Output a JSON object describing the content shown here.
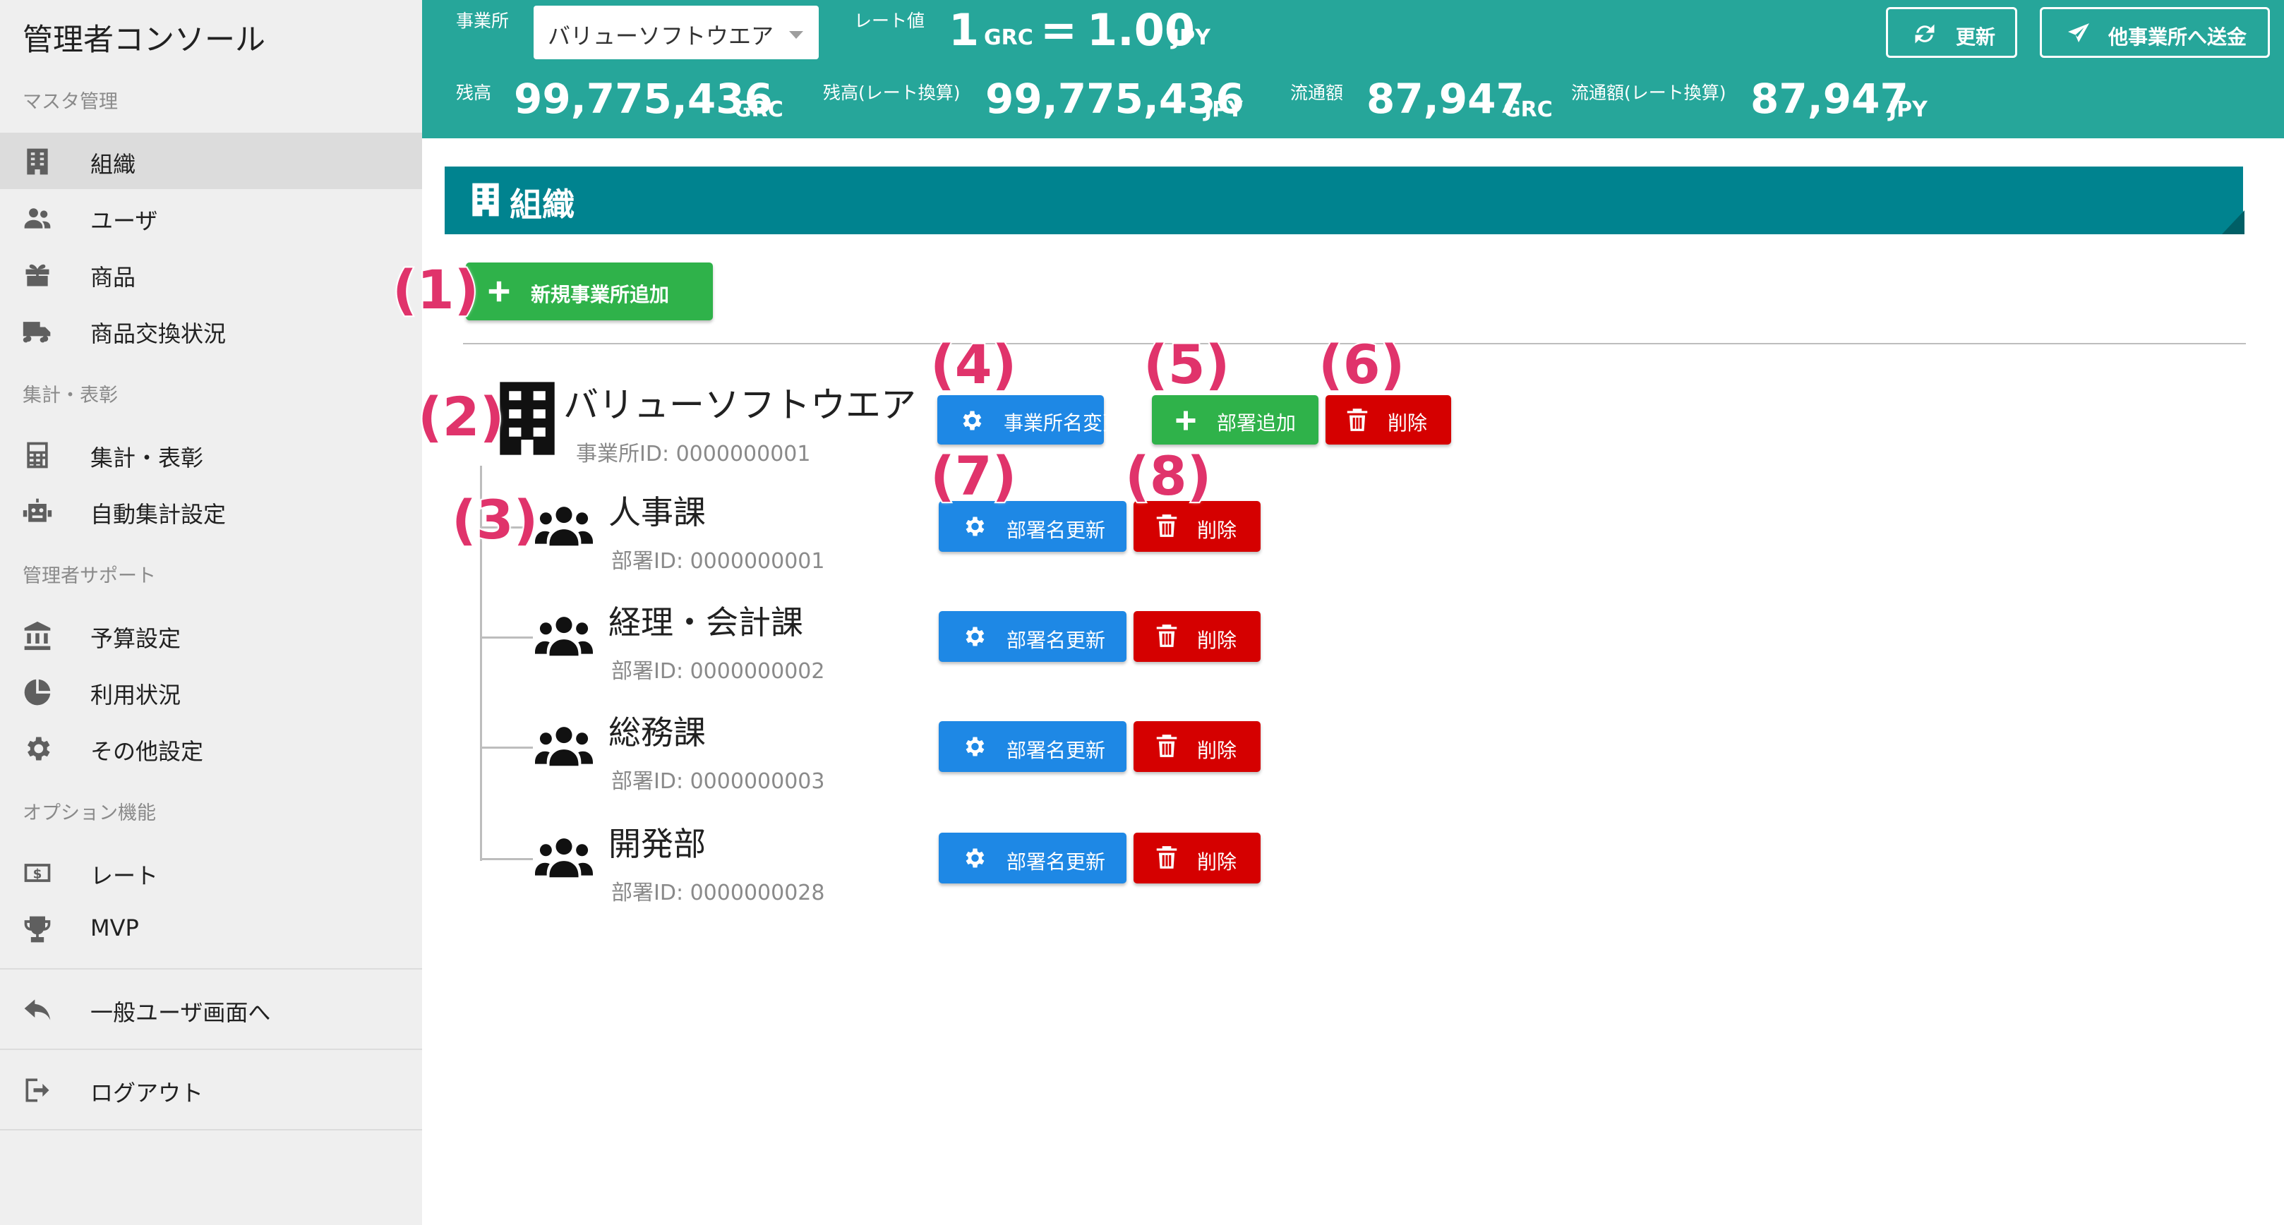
{
  "sidebar": {
    "app_title": "管理者コンソール",
    "sections": {
      "master": "マスタ管理",
      "reports": "集計・表彰",
      "support": "管理者サポート",
      "options": "オプション機能"
    },
    "items": {
      "organization": "組織",
      "users": "ユーザ",
      "products": "商品",
      "product_exchange": "商品交換状況",
      "reports": "集計・表彰",
      "auto_reports": "自動集計設定",
      "budget": "予算設定",
      "usage": "利用状況",
      "other_settings": "その他設定",
      "rate": "レート",
      "mvp": "MVP",
      "to_user_screen": "一般ユーザ画面へ",
      "logout": "ログアウト"
    }
  },
  "topbar": {
    "office_label": "事業所",
    "office_selected": "バリューソフトウエア",
    "rate_label": "レート値",
    "rate_left": "1",
    "rate_left_unit": "GRC",
    "rate_eq": "=",
    "rate_right": "1.00",
    "rate_right_unit": "JPY",
    "balance_label": "残高",
    "balance_value": "99,775,436",
    "balance_unit": "GRC",
    "balance_rate_label": "残高(レート換算)",
    "balance_rate_value": "99,775,436",
    "balance_rate_unit": "JPY",
    "circulation_label": "流通額",
    "circulation_value": "87,947",
    "circulation_unit": "GRC",
    "circulation_rate_label": "流通額(レート換算)",
    "circulation_rate_value": "87,947",
    "circulation_rate_unit": "JPY",
    "refresh_button": "更新",
    "send_button": "他事業所へ送金"
  },
  "page": {
    "title": "組織",
    "add_office_button": "新規事業所追加"
  },
  "office": {
    "name": "バリューソフトウエア",
    "id_text": "事業所ID: 0000000001",
    "rename_button": "事業所名変更",
    "add_dept_button": "部署追加",
    "delete_button": "削除"
  },
  "departments": [
    {
      "name": "人事課",
      "id_text": "部署ID: 0000000001",
      "update_button": "部署名更新",
      "delete_button": "削除"
    },
    {
      "name": "経理・会計課",
      "id_text": "部署ID: 0000000002",
      "update_button": "部署名更新",
      "delete_button": "削除"
    },
    {
      "name": "総務課",
      "id_text": "部署ID: 0000000003",
      "update_button": "部署名更新",
      "delete_button": "削除"
    },
    {
      "name": "開発部",
      "id_text": "部署ID: 0000000028",
      "update_button": "部署名更新",
      "delete_button": "削除"
    }
  ],
  "annotations": [
    "(1)",
    "(2)",
    "(3)",
    "(4)",
    "(5)",
    "(6)",
    "(7)",
    "(8)"
  ],
  "colors": {
    "topbar": "#26a69a",
    "page_header": "#00838f",
    "green": "#2fb24a",
    "blue": "#1e88e5",
    "red": "#d50000",
    "annotation": "#e0336b"
  }
}
